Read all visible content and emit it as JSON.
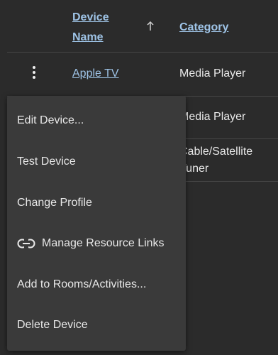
{
  "table": {
    "headers": {
      "device_name": "Device Name",
      "category": "Category"
    },
    "sort": {
      "column": "device_name",
      "direction": "ascending",
      "icon": "arrow-up-icon"
    },
    "rows": [
      {
        "name": "Apple TV",
        "category": "Media Player"
      },
      {
        "name": "",
        "category": "Media Player"
      },
      {
        "name": "",
        "category": "Cable/Satellite Tuner"
      }
    ]
  },
  "context_menu": {
    "items": [
      {
        "label": "Edit Device..."
      },
      {
        "label": "Test Device"
      },
      {
        "label": "Change Profile"
      },
      {
        "label": "Manage Resource Links",
        "icon": "link-icon"
      },
      {
        "label": "Add to Rooms/Activities..."
      },
      {
        "label": "Delete Device"
      }
    ]
  },
  "colors": {
    "background": "#2b2b2b",
    "menu_background": "#3a3a3a",
    "link": "#9ec3e6",
    "text": "#e8e8e8",
    "divider": "#464646"
  }
}
